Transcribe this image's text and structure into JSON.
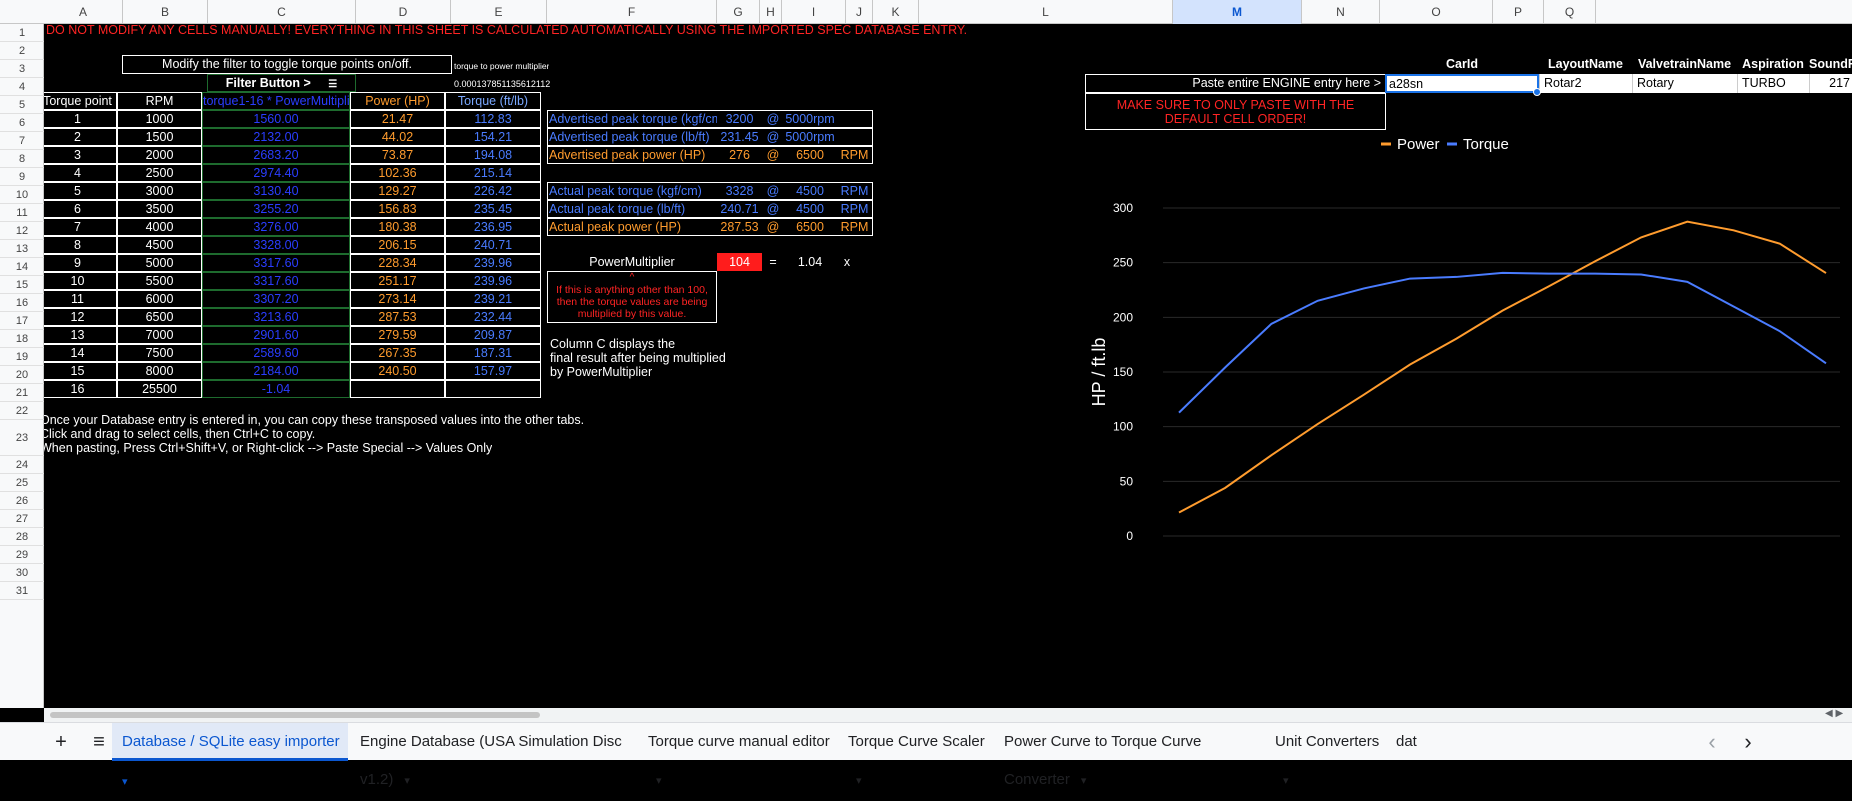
{
  "columns": [
    "A",
    "B",
    "C",
    "D",
    "E",
    "F",
    "G",
    "H",
    "I",
    "J",
    "K",
    "L",
    "M",
    "N",
    "O",
    "P",
    "Q"
  ],
  "rows": [
    "1",
    "2",
    "3",
    "4",
    "5",
    "6",
    "7",
    "8",
    "9",
    "10",
    "11",
    "12",
    "13",
    "14",
    "15",
    "16",
    "17",
    "18",
    "19",
    "20",
    "21",
    "22",
    "23",
    "24",
    "25",
    "26",
    "27",
    "28",
    "29",
    "30",
    "31"
  ],
  "warning": "DO NOT MODIFY ANY CELLS MANUALLY! EVERYTHING IN THIS SHEET IS CALCULATED AUTOMATICALLY USING THE IMPORTED SPEC DATABASE ENTRY.",
  "filter_hint": "Modify the filter to toggle torque points on/off.",
  "multiplier_label": "torque to power multiplier",
  "multiplier_value": "0.000137851135612112",
  "filter_button": "Filter Button >",
  "table": {
    "headers": [
      "Torque point",
      "RPM",
      "torque1-16 * PowerMultiplier",
      "Power (HP)",
      "Torque (ft/lb)"
    ],
    "rows": [
      [
        "1",
        "1000",
        "1560.00",
        "21.47",
        "112.83"
      ],
      [
        "2",
        "1500",
        "2132.00",
        "44.02",
        "154.21"
      ],
      [
        "3",
        "2000",
        "2683.20",
        "73.87",
        "194.08"
      ],
      [
        "4",
        "2500",
        "2974.40",
        "102.36",
        "215.14"
      ],
      [
        "5",
        "3000",
        "3130.40",
        "129.27",
        "226.42"
      ],
      [
        "6",
        "3500",
        "3255.20",
        "156.83",
        "235.45"
      ],
      [
        "7",
        "4000",
        "3276.00",
        "180.38",
        "236.95"
      ],
      [
        "8",
        "4500",
        "3328.00",
        "206.15",
        "240.71"
      ],
      [
        "9",
        "5000",
        "3317.60",
        "228.34",
        "239.96"
      ],
      [
        "10",
        "5500",
        "3317.60",
        "251.17",
        "239.96"
      ],
      [
        "11",
        "6000",
        "3307.20",
        "273.14",
        "239.21"
      ],
      [
        "12",
        "6500",
        "3213.60",
        "287.53",
        "232.44"
      ],
      [
        "13",
        "7000",
        "2901.60",
        "279.59",
        "209.87"
      ],
      [
        "14",
        "7500",
        "2589.60",
        "267.35",
        "187.31"
      ],
      [
        "15",
        "8000",
        "2184.00",
        "240.50",
        "157.97"
      ],
      [
        "16",
        "25500",
        "-1.04",
        "",
        ""
      ]
    ]
  },
  "peaks": {
    "adv_torque_kgf": {
      "label": "Advertised peak torque (kgf/cm)",
      "value": "3200",
      "at": "@",
      "rpm": "5000rpm",
      "unit": ""
    },
    "adv_torque_lbft": {
      "label": "Advertised peak torque (lb/ft)",
      "value": "231.45",
      "at": "@",
      "rpm": "5000rpm",
      "unit": ""
    },
    "adv_power": {
      "label": "Advertised peak power (HP)",
      "value": "276",
      "at": "@",
      "rpm": "6500",
      "unit": "RPM"
    },
    "act_torque_kgf": {
      "label": "Actual peak torque (kgf/cm)",
      "value": "3328",
      "at": "@",
      "rpm": "4500",
      "unit": "RPM"
    },
    "act_torque_lbft": {
      "label": "Actual peak torque (lb/ft)",
      "value": "240.71",
      "at": "@",
      "rpm": "4500",
      "unit": "RPM"
    },
    "act_power": {
      "label": "Actual peak power (HP)",
      "value": "287.53",
      "at": "@",
      "rpm": "6500",
      "unit": "RPM"
    }
  },
  "power_multiplier": {
    "label": "PowerMultiplier",
    "value": "104",
    "eq": "=",
    "factor": "1.04",
    "x": "x"
  },
  "pm_note_caret": "^",
  "pm_note": "If this is anything other than 100, then the torque values are being multiplied by this value.",
  "col_c_note": [
    "Column C displays the",
    "final result after being multiplied",
    "by PowerMultiplier"
  ],
  "instructions": [
    "Once your Database entry is entered in, you can copy these transposed values into the other tabs.",
    "Click and drag to select cells, then Ctrl+C to copy.",
    "When pasting, Press Ctrl+Shift+V, or Right-click --> Paste Special --> Values Only"
  ],
  "engine": {
    "headers": [
      "CarId",
      "LayoutName",
      "ValvetrainName",
      "Aspiration",
      "SoundF"
    ],
    "paste_label": "Paste entire ENGINE entry here >",
    "values": [
      "a28sn",
      "Rotar2",
      "Rotary",
      "TURBO",
      "217"
    ],
    "note": "MAKE SURE TO ONLY PASTE WITH THE DEFAULT CELL ORDER!"
  },
  "chart_data": {
    "type": "line",
    "x": [
      "1000",
      "1500",
      "2000",
      "2500",
      "3000",
      "3500",
      "4000",
      "4500",
      "5000",
      "5500",
      "6000",
      "6500",
      "7000",
      "7500",
      "8000"
    ],
    "series": [
      {
        "name": "Power",
        "color": "#ff9c2e",
        "values": [
          21.47,
          44.02,
          73.87,
          102.36,
          129.27,
          156.83,
          180.38,
          206.15,
          228.34,
          251.17,
          273.14,
          287.53,
          279.59,
          267.35,
          240.5
        ]
      },
      {
        "name": "Torque",
        "color": "#4a7cff",
        "values": [
          112.83,
          154.21,
          194.08,
          215.14,
          226.42,
          235.45,
          236.95,
          240.71,
          239.96,
          239.96,
          239.21,
          232.44,
          209.87,
          187.31,
          157.97
        ]
      }
    ],
    "ylabel": "HP / ft.lb",
    "yticks": [
      "0",
      "50",
      "100",
      "150",
      "200",
      "250",
      "300"
    ],
    "ylim": [
      0,
      300
    ],
    "legend": "top"
  },
  "tabs": [
    {
      "label": "Database / SQLite easy importer",
      "active": true
    },
    {
      "label": "Engine Database (USA Simulation Disc v1.2)"
    },
    {
      "label": "Torque curve manual editor"
    },
    {
      "label": "Torque Curve Scaler"
    },
    {
      "label": "Power Curve to Torque Curve Converter"
    },
    {
      "label": "Unit Converters"
    },
    {
      "label": "dat"
    }
  ],
  "icons": {
    "add": "+",
    "menu": "≡",
    "prev": "‹",
    "next": "›"
  }
}
